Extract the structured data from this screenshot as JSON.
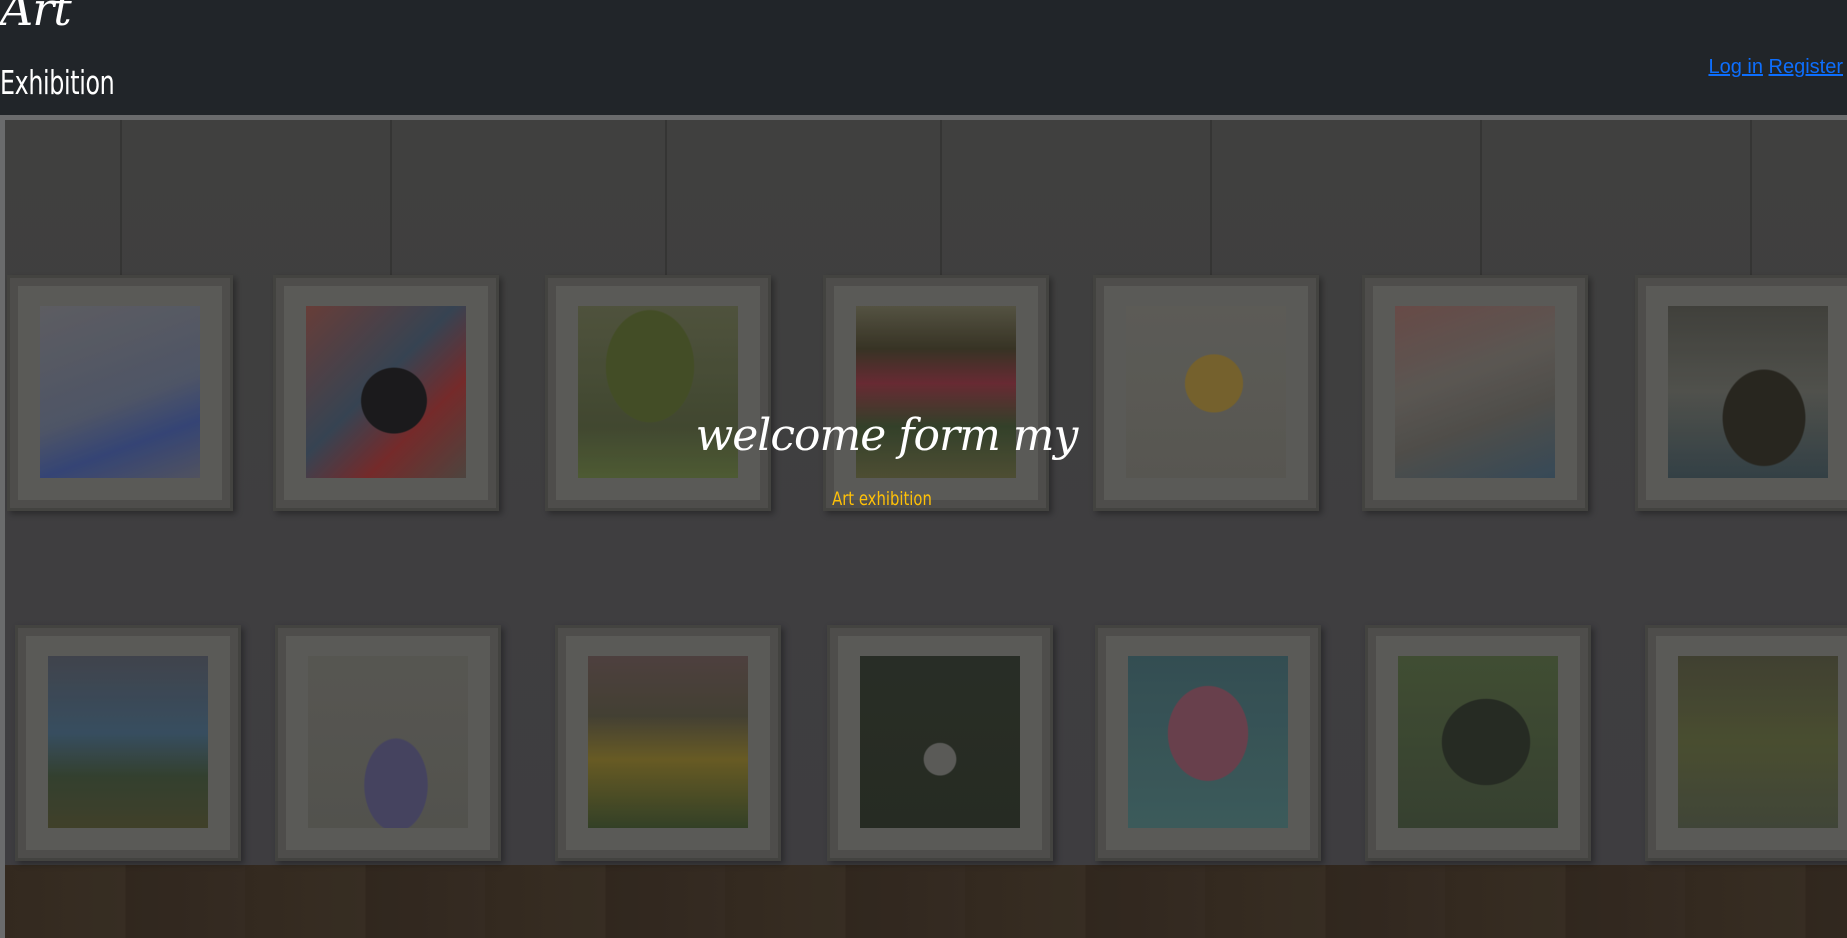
{
  "header": {
    "logo_script": "Art",
    "logo_title": "Exhibition",
    "login_label": "Log in",
    "register_label": "Register"
  },
  "hero": {
    "title": "welcome form my",
    "subtitle": "Art exhibition"
  },
  "colors": {
    "header_bg": "#212529",
    "link": "#0d6efd",
    "subtitle": "#ffc107",
    "title": "#ffffff"
  }
}
